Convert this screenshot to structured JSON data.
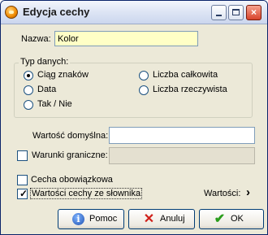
{
  "window": {
    "title": "Edycja cechy",
    "controls": {
      "minimize": "minimize",
      "maximize": "maximize",
      "close": "×"
    }
  },
  "form": {
    "name_label": "Nazwa:",
    "name_value": "Kolor",
    "data_type": {
      "legend": "Typ danych:",
      "options": [
        "Ciąg znaków",
        "Liczba całkowita",
        "Data",
        "Liczba rzeczywista",
        "Tak / Nie"
      ],
      "selected": "Ciąg znaków"
    },
    "default_label": "Wartość domyślna:",
    "default_value": "",
    "bounds_label": "Warunki graniczne:",
    "bounds_value": "",
    "bounds_checked": false,
    "mandatory_label": "Cecha obowiązkowa",
    "mandatory_checked": false,
    "dictionary_label": "Wartości cechy ze słownika",
    "dictionary_checked": true,
    "values_link": "Wartości:",
    "values_arrow": "›"
  },
  "buttons": {
    "help": "Pomoc",
    "cancel": "Anuluj",
    "ok": "OK"
  },
  "icons": {
    "help": "info-icon",
    "cancel": "x-icon",
    "ok": "checkmark-icon"
  }
}
